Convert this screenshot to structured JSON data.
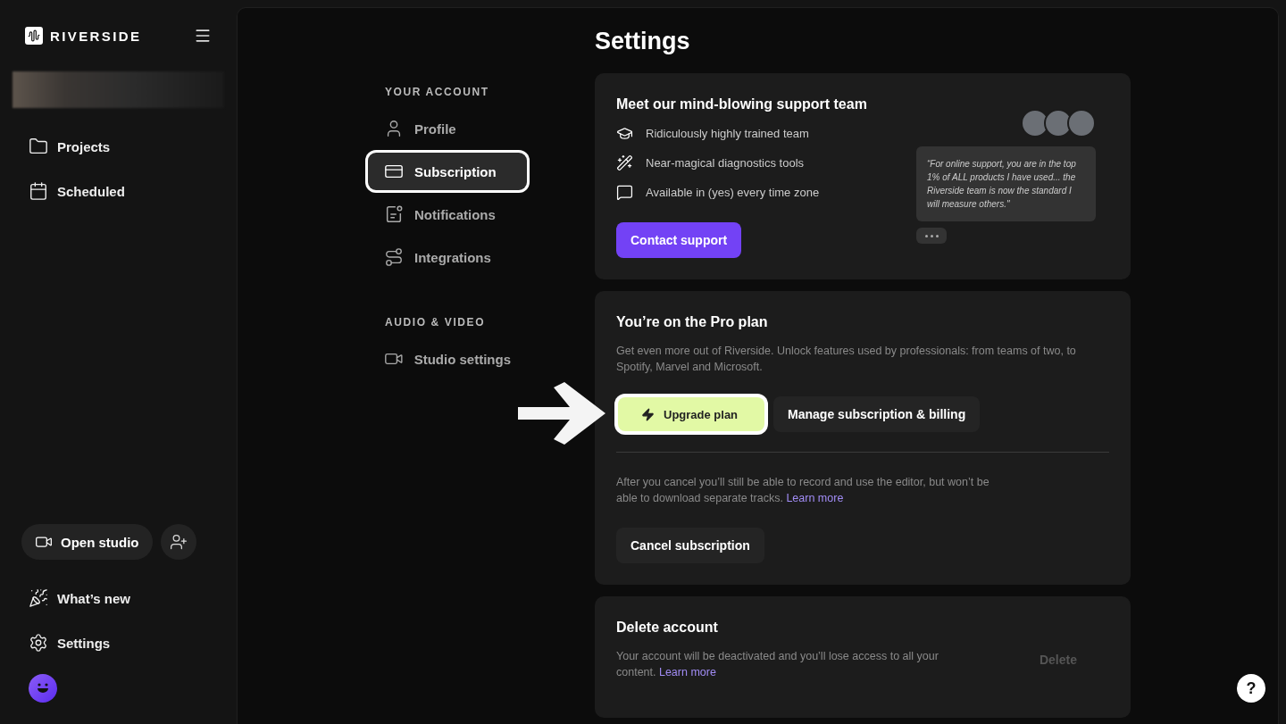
{
  "sidebar": {
    "logo": "RIVERSIDE",
    "nav": [
      {
        "label": "Projects"
      },
      {
        "label": "Scheduled"
      }
    ],
    "open_studio": "Open studio",
    "links": [
      {
        "label": "What’s new"
      },
      {
        "label": "Settings"
      }
    ]
  },
  "page": {
    "title": "Settings"
  },
  "settings_nav": [
    {
      "heading": "YOUR ACCOUNT",
      "items": [
        {
          "label": "Profile",
          "selected": false
        },
        {
          "label": "Subscription",
          "selected": true
        },
        {
          "label": "Notifications",
          "selected": false
        },
        {
          "label": "Integrations",
          "selected": false
        }
      ]
    },
    {
      "heading": "AUDIO & VIDEO",
      "items": [
        {
          "label": "Studio settings",
          "selected": false
        }
      ]
    }
  ],
  "support_card": {
    "title": "Meet our mind-blowing support team",
    "features": [
      "Ridiculously highly trained team",
      "Near-magical diagnostics tools",
      "Available in (yes) every time zone"
    ],
    "button": "Contact support",
    "quote": "“For online support, you are in the top 1% of ALL products I have used... the Riverside team is now the standard I will measure others.\""
  },
  "plan_card": {
    "title": "You’re on the Pro plan",
    "description": "Get even more out of Riverside. Unlock features used by professionals: from teams of two, to Spotify, Marvel and Microsoft.",
    "upgrade_button": "Upgrade plan",
    "manage_button": "Manage subscription & billing",
    "cancel_note": "After you cancel you’ll still be able to record and use the editor, but won’t be able to download separate tracks.",
    "cancel_link": "Learn more",
    "cancel_button": "Cancel subscription"
  },
  "delete_card": {
    "title": "Delete account",
    "description": "Your account will be deactivated and you’ll lose access to all your content.",
    "link": "Learn more",
    "button": {
      "label": "Delete",
      "disabled": true
    }
  },
  "help_button": "?"
}
